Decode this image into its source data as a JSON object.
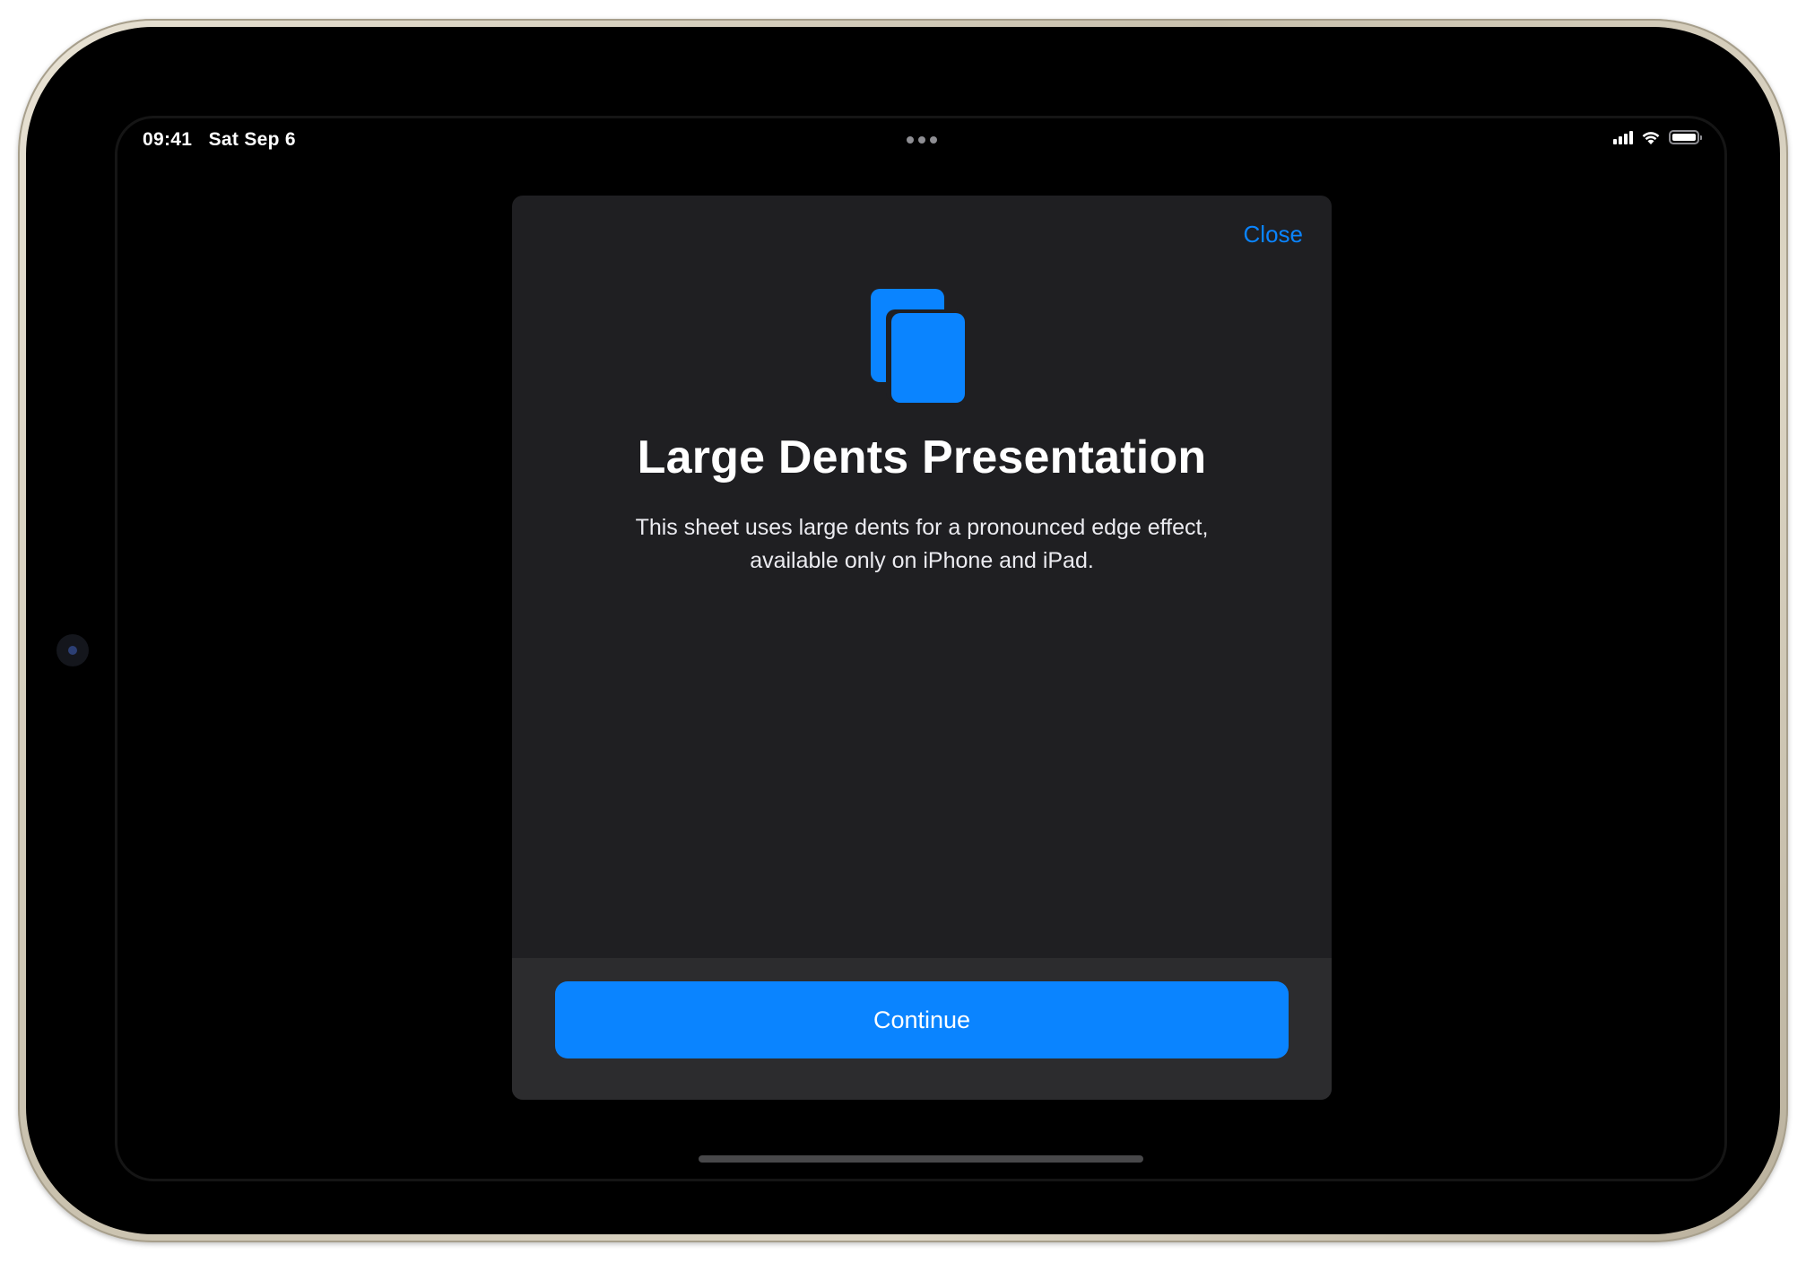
{
  "status_bar": {
    "time": "09:41",
    "date": "Sat Sep 6",
    "icons": [
      "signal-icon",
      "wifi-icon",
      "battery-icon"
    ]
  },
  "sheet": {
    "close_label": "Close",
    "icon": "documents-icon",
    "title": "Large Dents Presentation",
    "body_line1": "This sheet uses large dents for a pronounced edge effect,",
    "body_line2": "available only on iPhone and iPad.",
    "continue_label": "Continue"
  },
  "colors": {
    "accent": "#0a84ff",
    "sheet_background": "#1f1f22",
    "footer_background": "#2c2c2e",
    "screen_background": "#000000"
  }
}
